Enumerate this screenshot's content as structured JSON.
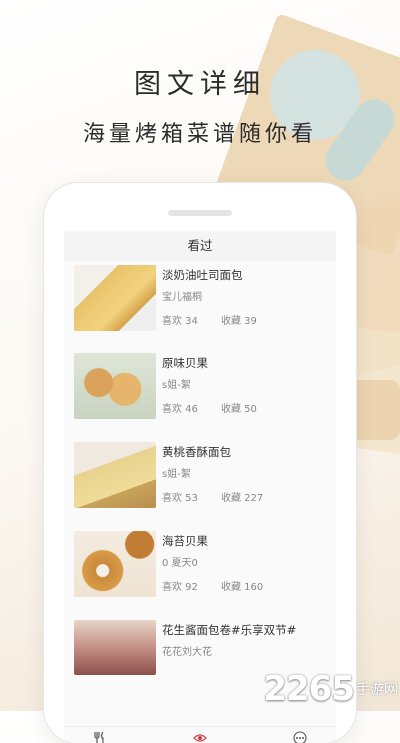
{
  "promo": {
    "title": "图文详细",
    "subtitle": "海量烤箱菜谱随你看"
  },
  "app": {
    "page_title": "看过",
    "items": [
      {
        "title": "淡奶油吐司面包",
        "author": "宝儿福桐",
        "likes": "喜欢 34",
        "favorites": "收藏 39"
      },
      {
        "title": "原味贝果",
        "author": "s姐-絮",
        "likes": "喜欢 46",
        "favorites": "收藏 50"
      },
      {
        "title": "黄桃香酥面包",
        "author": "s姐-絮",
        "likes": "喜欢 53",
        "favorites": "收藏 227"
      },
      {
        "title": "海苔贝果",
        "author": "0 夏天0",
        "likes": "喜欢 92",
        "favorites": "收藏 160"
      },
      {
        "title": "花生酱面包卷#乐享双节#",
        "author": "花花刘大花"
      }
    ],
    "tabs": [
      {
        "label": "食谱",
        "icon": "utensils-icon",
        "active": false
      },
      {
        "label": "看过",
        "icon": "eye-icon",
        "active": true
      },
      {
        "label": "更多",
        "icon": "more-icon",
        "active": false
      }
    ],
    "accent_color": "#d03a3a"
  },
  "watermark": {
    "number": "2265",
    "suffix": "手游网",
    "domain_text": ".com"
  }
}
